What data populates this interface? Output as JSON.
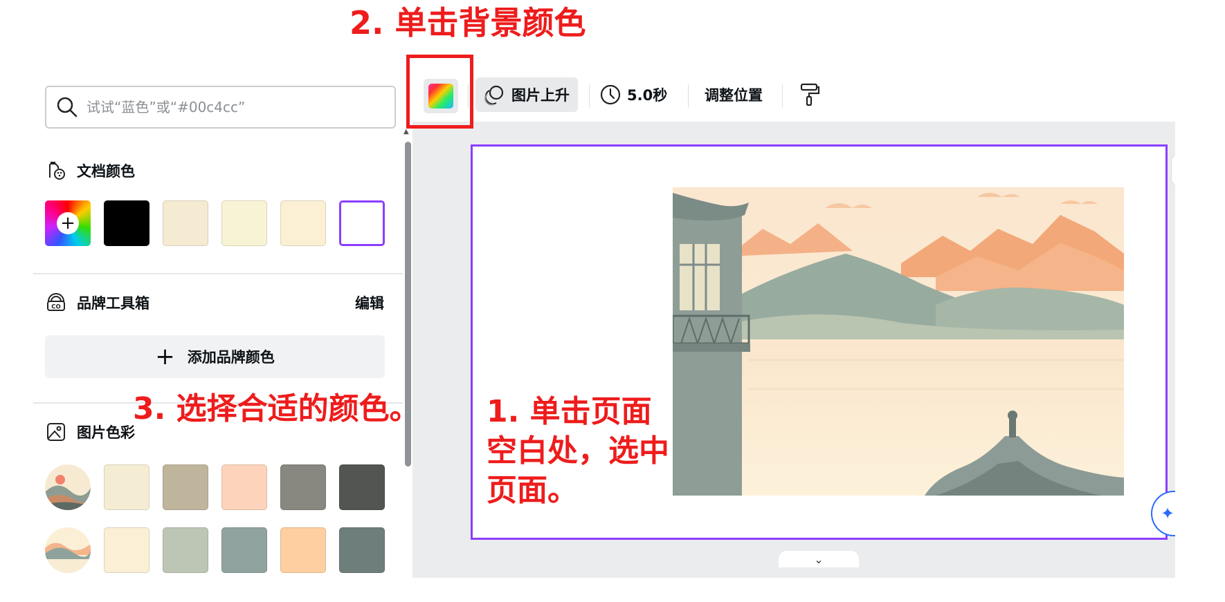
{
  "annotations": {
    "step2": "2. 单击背景颜色",
    "step3": "3. 选择合适的颜色。",
    "step1": "1. 单击页面空白处，选中页面。"
  },
  "search": {
    "placeholder": "试试“蓝色”或“#00c4cc”"
  },
  "document_colors": {
    "title": "文档颜色",
    "icon": "palette-doc-icon",
    "swatches": [
      "rainbow-add",
      "#000000",
      "#f5ebd2",
      "#f7f3d4",
      "#fbefd4",
      "#ffffff"
    ]
  },
  "brand_kit": {
    "title": "品牌工具箱",
    "icon": "brand-kit-icon",
    "edit_label": "编辑",
    "add_label": "添加品牌颜色"
  },
  "photo_colors": {
    "title": "图片色彩",
    "icon": "image-icon",
    "rows": [
      [
        "thumbnail",
        "#f4edd4",
        "#bfb59c",
        "#fdd3bb",
        "#888880",
        "#535553"
      ],
      [
        "thumbnail",
        "#fbefd6",
        "#bdc6b5",
        "#91a39e",
        "#fdcfa1",
        "#6e7e7b"
      ]
    ]
  },
  "toolbar": {
    "background_color_icon": "color-gradient-icon",
    "animation_label": "图片上升",
    "duration_label": "5.0秒",
    "position_label": "调整位置",
    "paint_format_icon": "paint-roller-icon"
  },
  "colors": {
    "annotation": "#ee1c1c",
    "selection": "#8b3dff",
    "ai_accent": "#2a6bff"
  }
}
